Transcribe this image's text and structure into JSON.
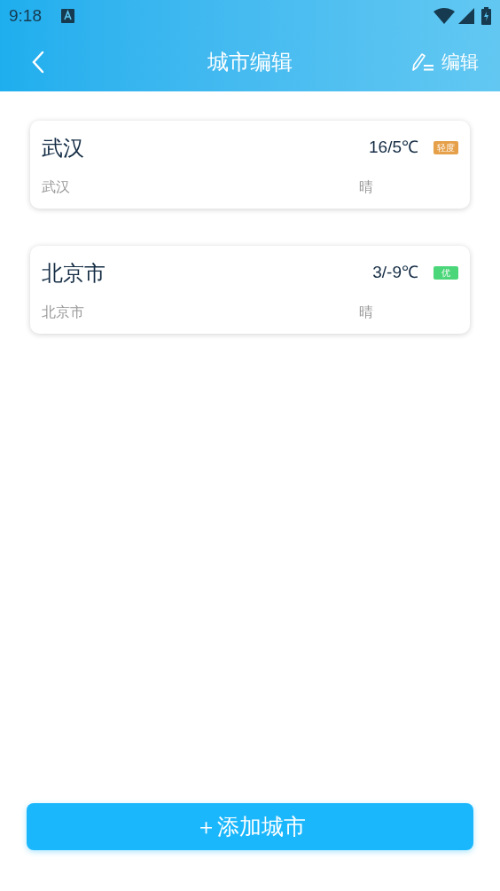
{
  "status_bar": {
    "time": "9:18"
  },
  "header": {
    "title": "城市编辑",
    "edit_label": "编辑"
  },
  "cities": [
    {
      "name": "武汉",
      "subtitle": "武汉",
      "temp": "16/5℃",
      "weather": "晴",
      "aqi": "轻度",
      "color": "#e6a04a"
    },
    {
      "name": "北京市",
      "subtitle": "北京市",
      "temp": "3/-9℃",
      "weather": "晴",
      "aqi": "优",
      "color": "#4cd67a"
    }
  ],
  "add_button": "＋添加城市"
}
